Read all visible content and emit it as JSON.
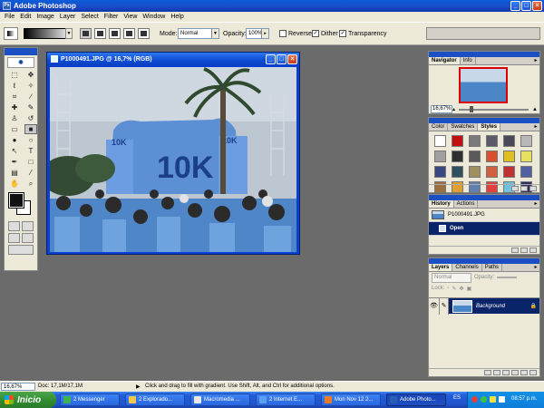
{
  "app": {
    "title": "Adobe Photoshop",
    "icon": "ps-icon"
  },
  "window_controls": {
    "minimize": "_",
    "maximize": "□",
    "close": "×"
  },
  "menu": [
    "File",
    "Edit",
    "Image",
    "Layer",
    "Select",
    "Filter",
    "View",
    "Window",
    "Help"
  ],
  "options": {
    "mode_label": "Mode:",
    "mode_value": "Normal",
    "opacity_label": "Opacity:",
    "opacity_value": "100%",
    "reverse_label": "Reverse",
    "dither_label": "Dither",
    "transparency_label": "Transparency",
    "reverse_checked": false,
    "dither_checked": true,
    "transparency_checked": true
  },
  "document": {
    "title": "P1000491.JPG @ 16,7% (RGB)",
    "banner_text": "10K"
  },
  "navigator": {
    "tabs": [
      "Navigator",
      "Info"
    ],
    "zoom": "16,67%"
  },
  "swatches": {
    "tabs": [
      "Color",
      "Swatches",
      "Styles"
    ],
    "colors": [
      "#ffffff",
      "#c01010",
      "#7a7a7a",
      "#5a5a6a",
      "#484858",
      "#b8b8b8",
      "#a0a0a0",
      "#303030",
      "#5a5a5a",
      "#d85030",
      "#e0c020",
      "#e8e060",
      "#3a4a80",
      "#305060",
      "#a09060",
      "#d06040",
      "#c03030",
      "#5060a0",
      "#9a7040",
      "#e0a030",
      "#6080b0",
      "#e04040",
      "#70c0e0",
      "#303060"
    ]
  },
  "history": {
    "tabs": [
      "History",
      "Actions"
    ],
    "snapshot": "P1000491.JPG",
    "step": "Open"
  },
  "layers": {
    "tabs": [
      "Layers",
      "Channels",
      "Paths"
    ],
    "blend": "Normal",
    "opacity_label": "Opacity:",
    "lock_label": "Lock:",
    "layer_name": "Background"
  },
  "status": {
    "zoom": "16,67%",
    "doc": "Doc: 17,1M/17,1M",
    "hint": "Click and drag to fill with gradient. Use Shift, Alt, and Ctrl for additional options."
  },
  "taskbar": {
    "start": "Inicio",
    "tasks": [
      "2 Messenger",
      "2 Explorado...",
      "Macromedia ...",
      "2 Internet E...",
      "Mon Nov 12 2...",
      "Adobe Photo..."
    ],
    "lang": "ES",
    "clock": "08:57 p.m."
  },
  "colors": {
    "xp_blue": "#1d49c9",
    "ps_panel": "#ece9d8",
    "workspace": "#6b6b6b",
    "start_green": "#2f8b2f"
  }
}
